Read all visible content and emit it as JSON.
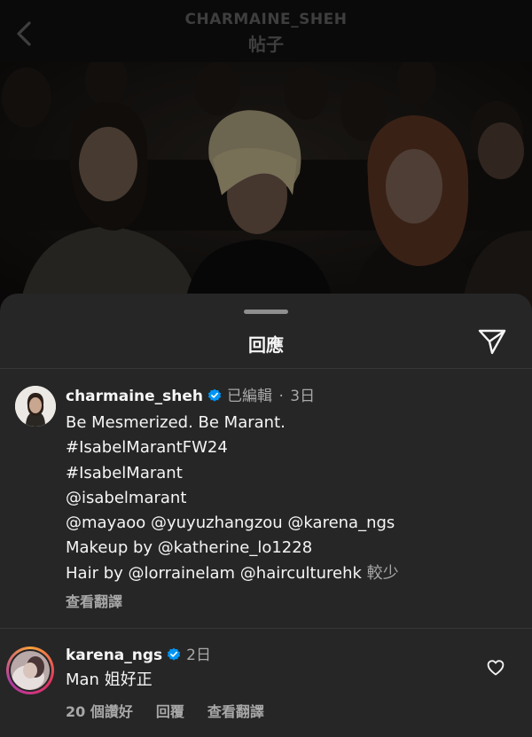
{
  "header": {
    "username": "CHARMAINE_SHEH",
    "title": "帖子",
    "back_icon": "chevron-left-icon"
  },
  "sheet": {
    "title": "回應",
    "share_icon": "paper-plane-icon"
  },
  "caption": {
    "username": "charmaine_sheh",
    "verified": true,
    "edited": "已編輯",
    "separator": "·",
    "time": "3日",
    "lines": [
      "Be Mesmerized. Be Marant.",
      "#IsabelMarantFW24",
      "#IsabelMarant",
      "@isabelmarant",
      "@mayaoo @yuyuzhangzou @karena_ngs",
      "Makeup by @katherine_lo1228"
    ],
    "last_line": "Hair by @lorrainelam @hairculturehk",
    "more": "較少",
    "translate": "查看翻譯"
  },
  "comment": {
    "username": "karena_ngs",
    "verified": true,
    "time": "2日",
    "text": "Man 姐好正",
    "likes": "20 個讚好",
    "reply": "回覆",
    "translate": "查看翻譯",
    "like_icon": "heart-outline-icon"
  },
  "colors": {
    "sheet_bg": "#262626",
    "primary_text": "#f5f5f5",
    "secondary_text": "#a8a8a8",
    "verified_blue": "#0095f6"
  }
}
